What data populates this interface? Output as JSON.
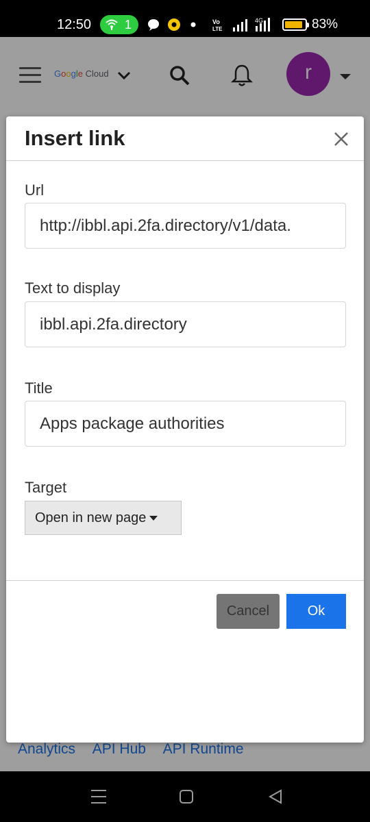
{
  "status_bar": {
    "time": "12:50",
    "hotspot_count": "1",
    "network_label": "VoLTE",
    "network_type": "4G",
    "battery_percent": "83%",
    "battery_level": 0.83
  },
  "app_header": {
    "brand": {
      "google": "Google",
      "cloud": "Cloud"
    },
    "avatar_letter": "r",
    "avatar_color": "#9c27b0",
    "icons": [
      "menu-icon",
      "chevron-down-icon",
      "search-icon",
      "bell-icon",
      "caret-down-icon"
    ]
  },
  "background_links": [
    "Analytics",
    "API Hub",
    "API Runtime"
  ],
  "dialog": {
    "title": "Insert link",
    "url_label": "Url",
    "url_value": "http://ibbl.api.2fa.directory/v1/data.",
    "display_label": "Text to display",
    "display_value": "ibbl.api.2fa.directory",
    "title_label": "Title",
    "title_value": "Apps package authorities",
    "target_label": "Target",
    "target_value": "Open in new page",
    "cancel_label": "Cancel",
    "ok_label": "Ok",
    "ok_color": "#1a73e8"
  }
}
